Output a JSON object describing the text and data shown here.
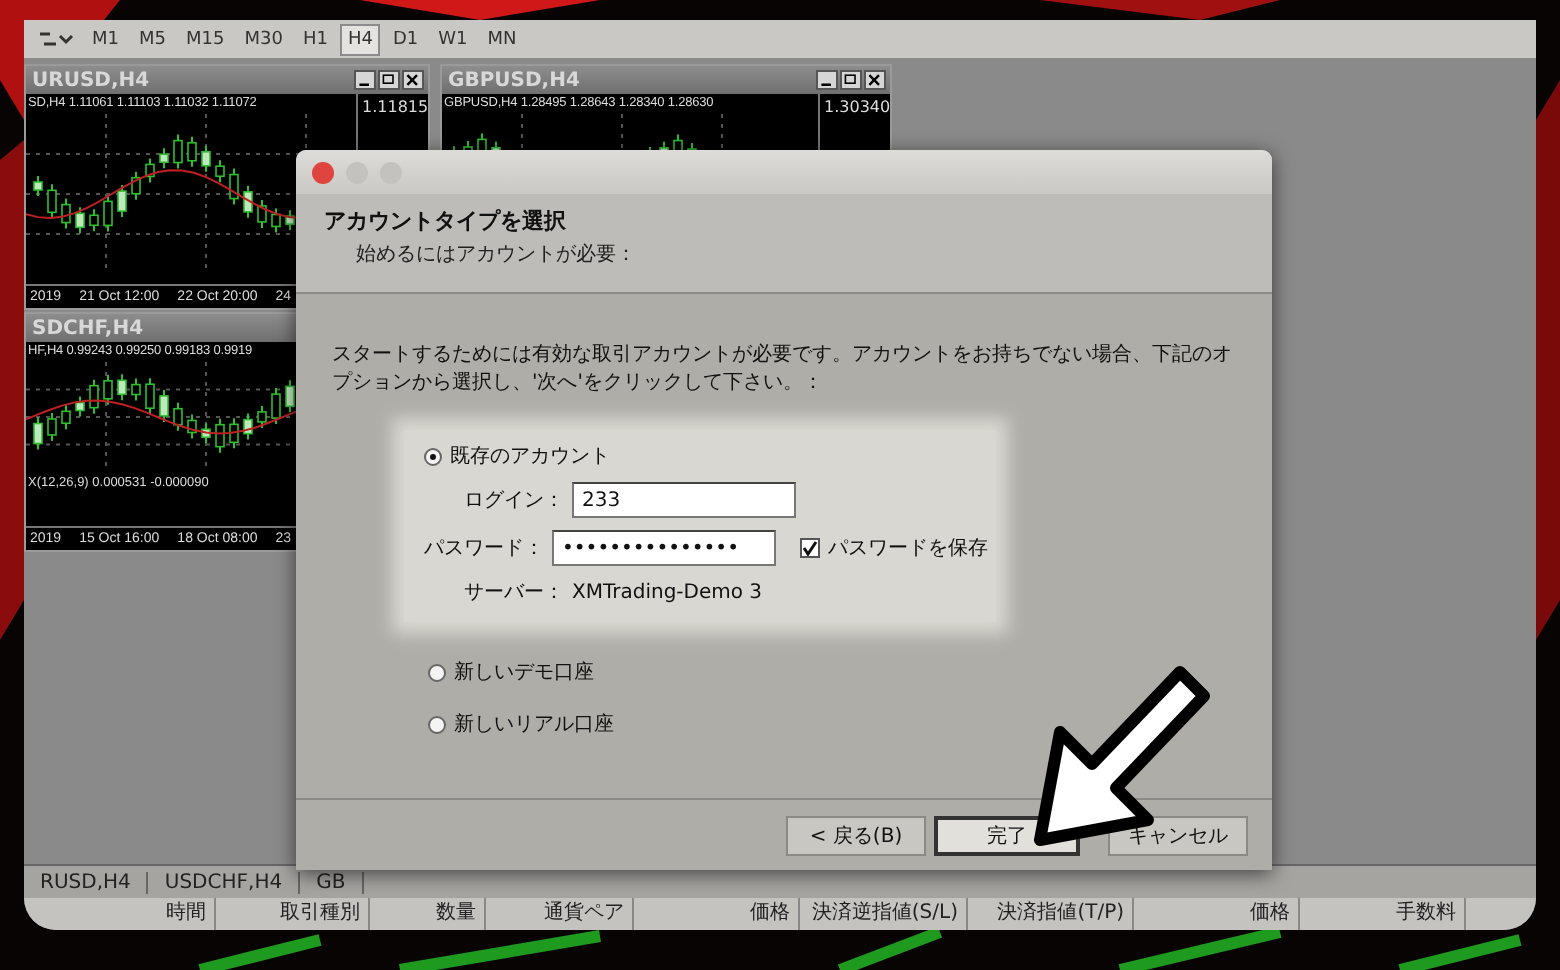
{
  "toolbar": {
    "timeframes": [
      {
        "label": "M1",
        "selected": false
      },
      {
        "label": "M5",
        "selected": false
      },
      {
        "label": "M15",
        "selected": false
      },
      {
        "label": "M30",
        "selected": false
      },
      {
        "label": "H1",
        "selected": false
      },
      {
        "label": "H4",
        "selected": true
      },
      {
        "label": "D1",
        "selected": false
      },
      {
        "label": "W1",
        "selected": false
      },
      {
        "label": "MN",
        "selected": false
      }
    ]
  },
  "chart_windows": [
    {
      "title": "URUSD,H4",
      "info": "SD,H4  1.11061 1.11103 1.11032 1.11072",
      "price_labels": [
        "1.11815"
      ],
      "time_labels": [
        "2019",
        "21 Oct 12:00",
        "22 Oct 20:00",
        "24"
      ]
    },
    {
      "title": "SDCHF,H4",
      "info": "HF,H4  0.99243 0.99250 0.99183 0.9919",
      "indicator": "X(12,26,9) 0.000531 -0.000090",
      "time_labels": [
        "2019",
        "15 Oct 16:00",
        "18 Oct 08:00",
        "23"
      ]
    },
    {
      "title": "GBPUSD,H4",
      "info": "GBPUSD,H4  1.28495 1.28643 1.28340 1.28630",
      "price_labels": [
        "1.30340"
      ]
    }
  ],
  "dialog": {
    "title": "アカウントタイプを選択",
    "subtitle": "始めるにはアカウントが必要：",
    "description": "スタートするためには有効な取引アカウントが必要です。アカウントをお持ちでない場合、下記のオプションから選択し、'次へ'をクリックして下さい。：",
    "options": [
      {
        "label": "既存のアカウント",
        "selected": true
      },
      {
        "label": "新しいデモ口座",
        "selected": false
      },
      {
        "label": "新しいリアル口座",
        "selected": false
      }
    ],
    "login_label": "ログイン：",
    "login_value": "233",
    "password_label": "パスワード：",
    "password_value": "•••••••••••••••",
    "save_password": {
      "label": "パスワードを保存",
      "checked": true
    },
    "server_label": "サーバー：",
    "server_value": "XMTrading-Demo 3",
    "buttons": [
      {
        "label": "< 戻る(B)",
        "default": false
      },
      {
        "label": "完了",
        "default": true
      },
      {
        "label": "キャンセル",
        "default": false
      }
    ]
  },
  "bottom_tabs": [
    "RUSD,H4",
    "USDCHF,H4",
    "GB"
  ],
  "columns": [
    "時間",
    "取引種別",
    "数量",
    "通貨ペア",
    "価格",
    "決済逆指値(S/L)",
    "決済指値(T/P)",
    "価格",
    "手数料"
  ]
}
